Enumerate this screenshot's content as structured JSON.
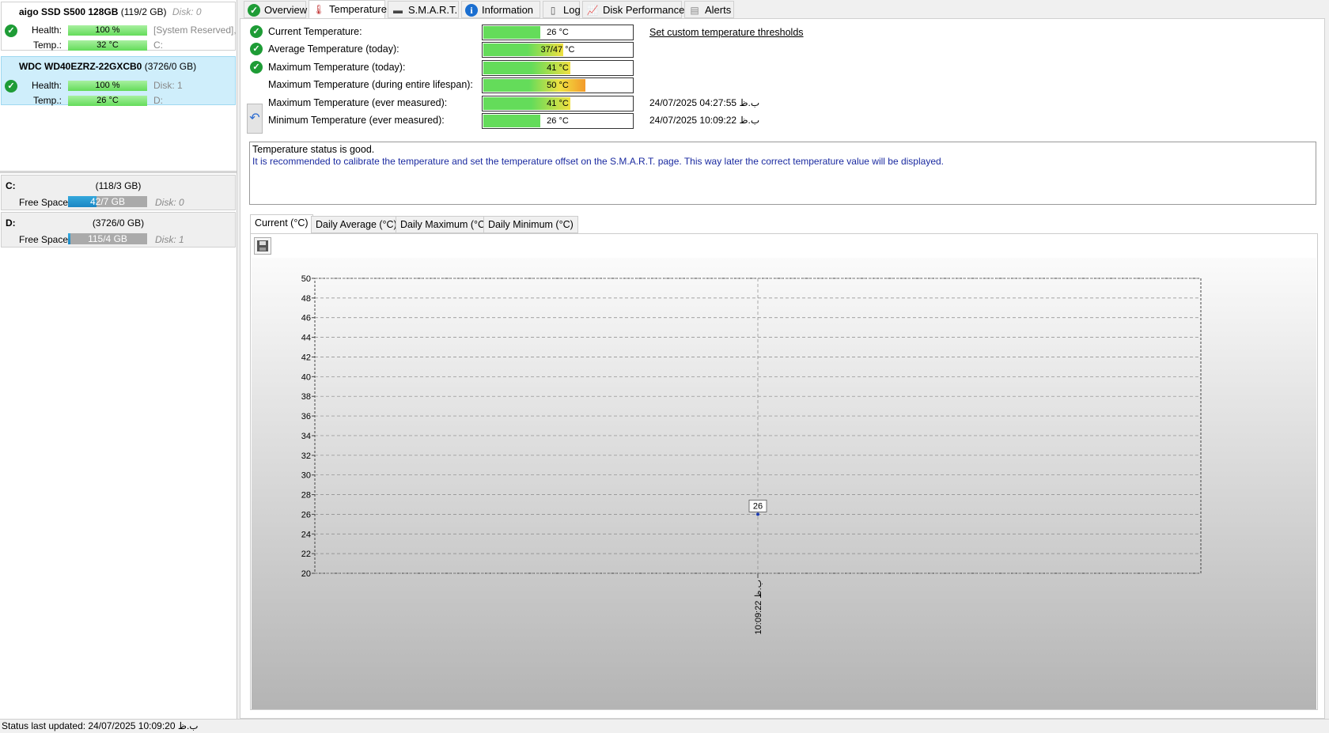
{
  "disks": [
    {
      "name": "aigo SSD S500 128GB",
      "size": "(119/2 GB)",
      "disk": "Disk: 0",
      "health_label": "Health:",
      "health": "100 %",
      "health_extra": "[System Reserved],",
      "temp_label": "Temp.:",
      "temp": "32 °C",
      "temp_extra": "C:"
    },
    {
      "name": "WDC WD40EZRZ-22GXCB0",
      "size": "(3726/0 GB)",
      "disk": "",
      "health_label": "Health:",
      "health": "100 %",
      "health_extra": "Disk: 1",
      "temp_label": "Temp.:",
      "temp": "26 °C",
      "temp_extra": "D:"
    }
  ],
  "volumes": [
    {
      "letter": "C:",
      "size": "(118/3 GB)",
      "free_label": "Free Space",
      "free": "42/7 GB",
      "free_fraction": 0.36,
      "disk": "Disk: 0"
    },
    {
      "letter": "D:",
      "size": "(3726/0 GB)",
      "free_label": "Free Space",
      "free": "115/4 GB",
      "free_fraction": 0.03,
      "disk": "Disk: 1"
    }
  ],
  "tabs": [
    "Overview",
    "Temperature",
    "S.M.A.R.T.",
    "Information",
    "Log",
    "Disk Performance",
    "Alerts"
  ],
  "active_tab": "Temperature",
  "temps": {
    "threshold_link": "Set custom temperature thresholds",
    "rows": [
      {
        "label": "Current Temperature:",
        "value": "26 °C",
        "level": 0.38,
        "stamp": ""
      },
      {
        "label": "Average Temperature (today):",
        "value": "37/47 °C",
        "level": 0.53,
        "stamp": ""
      },
      {
        "label": "Maximum Temperature (today):",
        "value": "41 °C",
        "level": 0.58,
        "stamp": ""
      },
      {
        "label": "Maximum Temperature (during entire lifespan):",
        "value": "50 °C",
        "level": 0.68,
        "stamp": ""
      },
      {
        "label": "Maximum Temperature (ever measured):",
        "value": "41 °C",
        "level": 0.58,
        "stamp": "24/07/2025 04:27:55 ب.ظ"
      },
      {
        "label": "Minimum Temperature (ever measured):",
        "value": "26 °C",
        "level": 0.38,
        "stamp": "24/07/2025 10:09:22 ب.ظ"
      }
    ]
  },
  "message": {
    "status": "Temperature status is good.",
    "advice": "It is recommended to calibrate the temperature and set the temperature offset on the S.M.A.R.T. page. This way later the correct temperature value will be displayed."
  },
  "chart_tabs": [
    "Current (°C)",
    "Daily Average (°C)",
    "Daily Maximum (°C)",
    "Daily Minimum (°C)"
  ],
  "chart_data": {
    "type": "line",
    "x": [
      "10:09:22 ب.ظ"
    ],
    "series": [
      {
        "values": [
          26
        ]
      }
    ],
    "ylim": [
      20,
      50
    ],
    "yticks": [
      20,
      22,
      24,
      26,
      28,
      30,
      32,
      34,
      36,
      38,
      40,
      42,
      44,
      46,
      48,
      50
    ],
    "title": "",
    "xlabel": "",
    "ylabel": "",
    "grid": true
  },
  "status_bar": "Status last updated: 24/07/2025 10:09:20 ب.ظ",
  "colors": {
    "ok": "#1e9c36",
    "bar_green": "#64dc5a",
    "bar_yellow": "#f0e040",
    "bar_orange": "#f39a2a",
    "free_blue": "#1a86c4"
  }
}
